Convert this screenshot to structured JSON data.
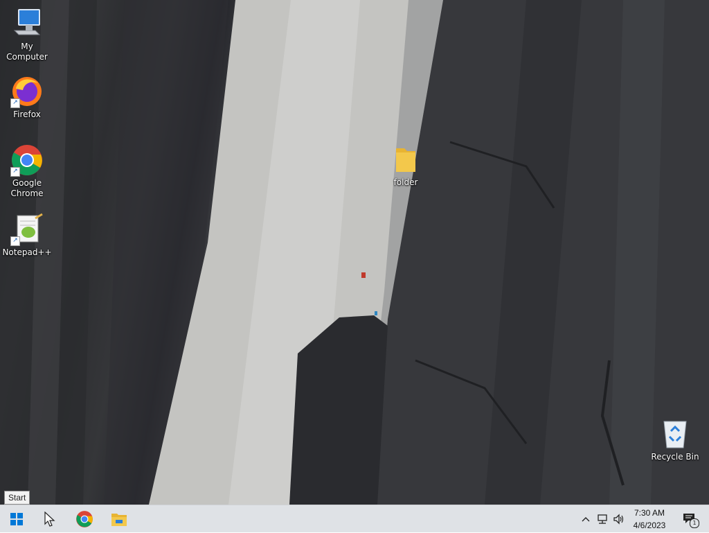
{
  "desktop": {
    "icons": [
      {
        "label": "My Computer"
      },
      {
        "label": "Firefox"
      },
      {
        "label": "Google Chrome"
      },
      {
        "label": "Notepad++"
      },
      {
        "label": "folder"
      },
      {
        "label": "Recycle Bin"
      }
    ]
  },
  "tooltip": {
    "text": "Start"
  },
  "taskbar": {
    "pinned": [
      "start-button",
      "search-cursor",
      "chrome",
      "file-explorer"
    ],
    "clock": {
      "time": "7:30 AM",
      "date": "4/6/2023"
    },
    "notification_count": "1"
  },
  "colors": {
    "taskbar": "#dfe2e6",
    "folder": "#f3c84b",
    "windows_blue": "#0078d7"
  }
}
